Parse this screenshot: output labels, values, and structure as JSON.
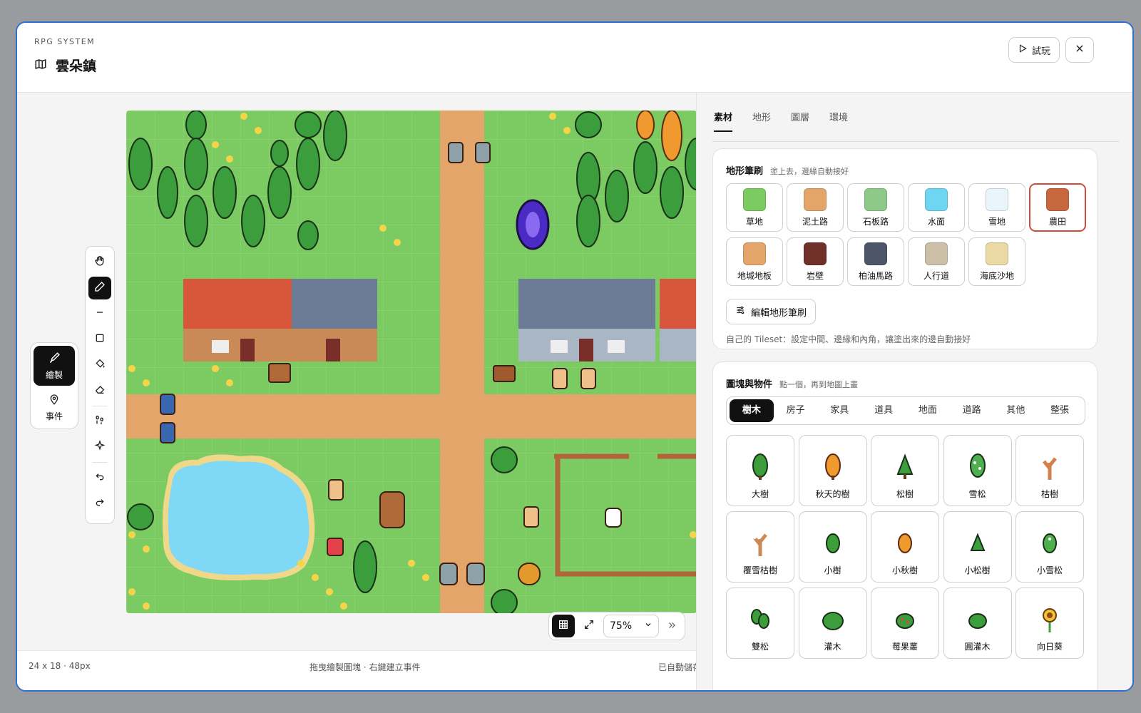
{
  "app": {
    "eyebrow": "RPG SYSTEM",
    "title": "雲朵鎮"
  },
  "header": {
    "play_label": "試玩"
  },
  "tools": [
    "hand-icon",
    "pencil-icon",
    "line-icon",
    "rectangle-icon",
    "fill-icon",
    "eraser-icon",
    "stamp-icon",
    "sparkle-icon",
    "undo-icon",
    "redo-icon"
  ],
  "modes": {
    "draw_label": "繪製",
    "event_label": "事件"
  },
  "zoom": {
    "value": "75%"
  },
  "footer": {
    "size": "24 x 18 · 48px",
    "hint": "拖曳繪製圖塊 · 右鍵建立事件",
    "status": "已自動儲存"
  },
  "tabs": [
    "素材",
    "地形",
    "圖層",
    "環境"
  ],
  "terrain": {
    "title": "地形筆刷",
    "subtitle": "塗上去，邊緣自動接好",
    "brushes": [
      {
        "label": "草地",
        "color": "#7ccb62"
      },
      {
        "label": "泥土路",
        "color": "#e4a56a"
      },
      {
        "label": "石板路",
        "color": "#8fc98a"
      },
      {
        "label": "水面",
        "color": "#6fd6f2"
      },
      {
        "label": "雪地",
        "color": "#eaf4fb"
      },
      {
        "label": "農田",
        "color": "#c8683e"
      },
      {
        "label": "地城地板",
        "color": "#e4a56a"
      },
      {
        "label": "岩壁",
        "color": "#6e3029"
      },
      {
        "label": "柏油馬路",
        "color": "#4d5569"
      },
      {
        "label": "人行道",
        "color": "#cbbfa8"
      },
      {
        "label": "海底沙地",
        "color": "#ead9a4"
      }
    ],
    "edit_label": "編輯地形筆刷",
    "note": "自己的 Tileset：設定中間、邊緣和內角，讓塗出來的邊自動接好"
  },
  "objects": {
    "title": "圖塊與物件",
    "subtitle": "點一個，再到地圖上畫",
    "categories": [
      "樹木",
      "房子",
      "家具",
      "道具",
      "地面",
      "道路",
      "其他",
      "整張"
    ],
    "items": [
      {
        "label": "大樹",
        "icon": "big-tree-icon"
      },
      {
        "label": "秋天的樹",
        "icon": "autumn-tree-icon"
      },
      {
        "label": "松樹",
        "icon": "pine-tree-icon"
      },
      {
        "label": "雪松",
        "icon": "snow-pine-icon"
      },
      {
        "label": "枯樹",
        "icon": "dead-tree-icon"
      },
      {
        "label": "覆雪枯樹",
        "icon": "snowy-dead-tree-icon"
      },
      {
        "label": "小樹",
        "icon": "small-tree-icon"
      },
      {
        "label": "小秋樹",
        "icon": "small-autumn-tree-icon"
      },
      {
        "label": "小松樹",
        "icon": "small-pine-icon"
      },
      {
        "label": "小雪松",
        "icon": "small-snow-pine-icon"
      },
      {
        "label": "雙松",
        "icon": "double-pine-icon"
      },
      {
        "label": "灌木",
        "icon": "bush-icon"
      },
      {
        "label": "莓果叢",
        "icon": "berry-bush-icon"
      },
      {
        "label": "圓灌木",
        "icon": "round-bush-icon"
      },
      {
        "label": "向日葵",
        "icon": "sunflower-icon"
      }
    ]
  }
}
